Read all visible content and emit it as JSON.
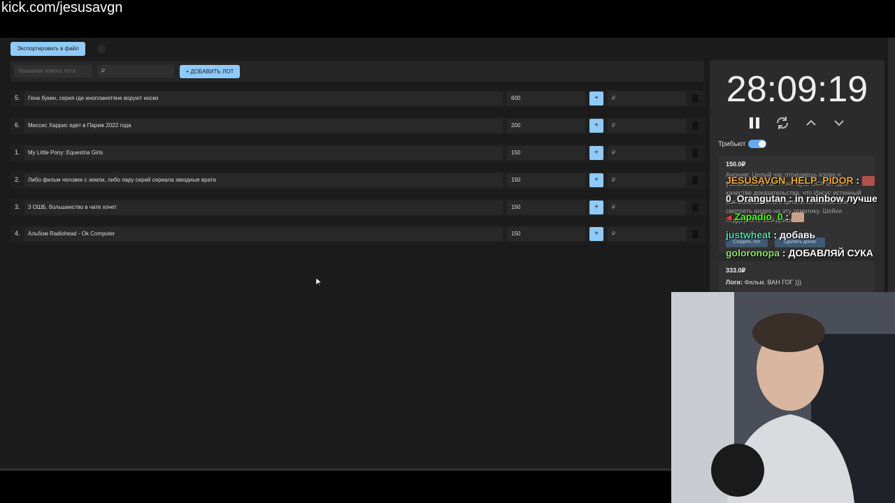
{
  "overlay": {
    "url": "kick.com/jesusavgn"
  },
  "toolbar": {
    "export_label": "Экспортировать в файл"
  },
  "new_lot": {
    "name_placeholder": "Название нового лота",
    "amount_placeholder": "₽",
    "add_label": "+ ДОБАВИТЬ ЛОТ"
  },
  "lots": [
    {
      "num": "5.",
      "name": "Гена букин, серия где инопланетяне воруют носки",
      "amount": "600",
      "add_placeholder": "₽"
    },
    {
      "num": "6.",
      "name": "Миссис Харрис едет в Париж 2022 года",
      "amount": "200",
      "add_placeholder": "₽"
    },
    {
      "num": "1.",
      "name": "My Little Pony: Equestria Girls",
      "amount": "150",
      "add_placeholder": "₽"
    },
    {
      "num": "2.",
      "name": "Либо фильм человек с земли, либо пару серий сериала звездные врата",
      "amount": "150",
      "add_placeholder": "₽"
    },
    {
      "num": "3.",
      "name": "3 ОШБ, большинство в чате хочет",
      "amount": "150",
      "add_placeholder": "₽"
    },
    {
      "num": "4.",
      "name": "Альбом Radiohead - Ok Computer",
      "amount": "150",
      "add_placeholder": "₽"
    }
  ],
  "plus_label": "+",
  "timer": {
    "value": "28:09:19"
  },
  "tribute": {
    "label": "Трибьют",
    "enabled": true
  },
  "donations": [
    {
      "amount": "150.0₽",
      "text": "Аноним: Целый час отрицаешь коран и усаживаеш в топ. Я лог аусь ОСХ оп един качестве доказательства, что Иисус истинный Бог можешь читать цитаты из библии или смотреть видео на эту тематику. Шейхи поддержите мой донат",
      "btn_create": "Создать лот",
      "btn_add": "Удалить донат"
    },
    {
      "amount": "333.0₽",
      "author": "Логи:",
      "text": " Фильм. ВАН ГОГ )))"
    }
  ],
  "chat": [
    {
      "user": "JESUSAVGN_HELP_PIDOR",
      "sep": " : ",
      "message": "",
      "color": "#f2a93b"
    },
    {
      "user": "0_Orangutan",
      "sep": " : ",
      "message": "in rainbow лучше",
      "color": "#ffffff"
    },
    {
      "user": "Zapadio_0",
      "sep": " : ",
      "message": "",
      "color": "#53fc18"
    },
    {
      "user": "justwheat",
      "sep": " : ",
      "message": "добавь",
      "color": "#5bd6a8"
    },
    {
      "user": "goloronopa",
      "sep": " : ",
      "message": "ДОБАВЛЯЙ СУКА",
      "color": "#8fe36a"
    }
  ],
  "colors": {
    "accent": "#90caf9",
    "background": "#1b1b1b",
    "toggle": "#64a9f4"
  }
}
